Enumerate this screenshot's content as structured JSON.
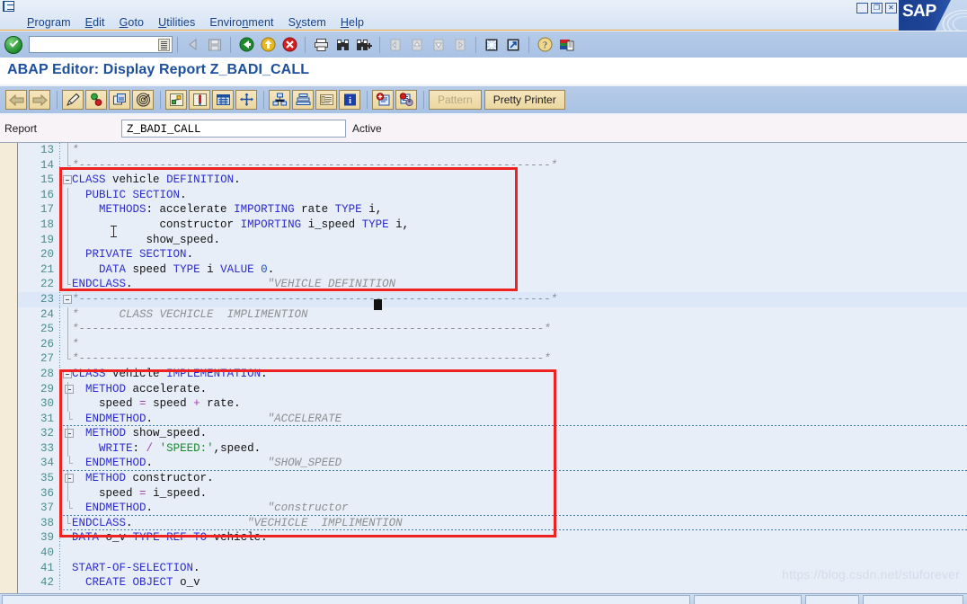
{
  "window": {
    "system_icon": "system-menu-icon",
    "controls": [
      {
        "name": "minimize-button",
        "glyph": "_"
      },
      {
        "name": "restore-button",
        "glyph": "❐"
      },
      {
        "name": "close-button",
        "glyph": "✕"
      }
    ],
    "brand": "SAP"
  },
  "menubar": {
    "items": [
      {
        "label": "Program",
        "mnemonic": "P"
      },
      {
        "label": "Edit",
        "mnemonic": "E"
      },
      {
        "label": "Goto",
        "mnemonic": "G"
      },
      {
        "label": "Utilities",
        "mnemonic": "U"
      },
      {
        "label": "Environment",
        "mnemonic": "n"
      },
      {
        "label": "System",
        "mnemonic": "y"
      },
      {
        "label": "Help",
        "mnemonic": "H"
      }
    ]
  },
  "toolbar": {
    "enter_button": "enter-ok-icon",
    "command_field": {
      "value": "",
      "placeholder": ""
    },
    "buttons": [
      {
        "name": "back-nav-icon",
        "title": "Back navigation"
      },
      {
        "name": "save-icon",
        "title": "Save"
      },
      {
        "name": "back-green-arrow-icon",
        "title": "Back"
      },
      {
        "name": "exit-yellow-arrow-icon",
        "title": "Exit"
      },
      {
        "name": "cancel-red-x-icon",
        "title": "Cancel"
      },
      {
        "name": "print-icon",
        "title": "Print"
      },
      {
        "name": "find-binoculars-icon",
        "title": "Find"
      },
      {
        "name": "find-next-icon",
        "title": "Find next"
      },
      {
        "name": "first-page-icon",
        "title": "First page"
      },
      {
        "name": "previous-page-icon",
        "title": "Previous page"
      },
      {
        "name": "next-page-icon",
        "title": "Next page"
      },
      {
        "name": "last-page-icon",
        "title": "Last page"
      },
      {
        "name": "create-session-icon",
        "title": "Create session"
      },
      {
        "name": "create-shortcut-icon",
        "title": "Create shortcut"
      },
      {
        "name": "help-question-icon",
        "title": "Help"
      },
      {
        "name": "customize-layout-icon",
        "title": "Customize local layout"
      }
    ]
  },
  "page": {
    "title": "ABAP Editor: Display Report Z_BADI_CALL"
  },
  "apptoolbar": {
    "buttons": [
      {
        "name": "back-arrow-icon",
        "title": "Back"
      },
      {
        "name": "forward-arrow-icon",
        "title": "Forward"
      },
      {
        "name": "display-change-pencil-icon",
        "title": "Display <-> Change"
      },
      {
        "name": "check-syntax-icon",
        "title": "Check"
      },
      {
        "name": "activate-icon",
        "title": "Activate"
      },
      {
        "name": "where-used-icon",
        "title": "Where-used list"
      },
      {
        "name": "navigation-stack-icon",
        "title": "Navigation"
      },
      {
        "name": "breakpoint-icon",
        "title": "Breakpoint"
      },
      {
        "name": "display-object-list-icon",
        "title": "Object list"
      },
      {
        "name": "other-object-icon",
        "title": "Other object"
      },
      {
        "name": "hierarchy-icon",
        "title": "Hierarchy"
      },
      {
        "name": "stack-layers-icon",
        "title": "Stack"
      },
      {
        "name": "list-table-icon",
        "title": "List"
      },
      {
        "name": "info-blue-icon",
        "title": "Information"
      },
      {
        "name": "insert-statement-icon",
        "title": "Insert statement"
      },
      {
        "name": "search-replace-icon",
        "title": "Search / replace"
      }
    ],
    "pattern_label": "Pattern",
    "pretty_printer_label": "Pretty Printer"
  },
  "reportrow": {
    "label": "Report",
    "value": "Z_BADI_CALL",
    "status": "Active"
  },
  "watermark": "https://blog.csdn.net/stuforever",
  "editor": {
    "lines": [
      {
        "n": "13",
        "fold": "",
        "vline": "mid",
        "text": "*"
      },
      {
        "n": "14",
        "fold": "",
        "vline": "endtick",
        "text": "*----------------------------------------------------------------------*"
      },
      {
        "n": "15",
        "fold": "minus",
        "vline": "",
        "text": "CLASS vehicle DEFINITION."
      },
      {
        "n": "16",
        "fold": "",
        "vline": "mid",
        "text": "  PUBLIC SECTION."
      },
      {
        "n": "17",
        "fold": "",
        "vline": "mid",
        "text": "    METHODS: accelerate IMPORTING rate TYPE i,"
      },
      {
        "n": "18",
        "fold": "",
        "vline": "mid",
        "text": "             constructor IMPORTING i_speed TYPE i,"
      },
      {
        "n": "19",
        "fold": "",
        "vline": "mid",
        "text": "           show_speed."
      },
      {
        "n": "20",
        "fold": "",
        "vline": "mid",
        "text": "  PRIVATE SECTION."
      },
      {
        "n": "21",
        "fold": "",
        "vline": "mid",
        "text": "    DATA speed TYPE i VALUE 0."
      },
      {
        "n": "22",
        "fold": "",
        "vline": "endtick",
        "text": "ENDCLASS.                    \"VEHICLE DEFINITION"
      },
      {
        "n": "23",
        "fold": "minus",
        "vline": "",
        "text": "*----------------------------------------------------------------------*"
      },
      {
        "n": "24",
        "fold": "",
        "vline": "mid",
        "text": "*      CLASS VECHICLE  IMPLIMENTION"
      },
      {
        "n": "25",
        "fold": "",
        "vline": "mid",
        "text": "*---------------------------------------------------------------------*"
      },
      {
        "n": "26",
        "fold": "",
        "vline": "mid",
        "text": "*"
      },
      {
        "n": "27",
        "fold": "",
        "vline": "endtick",
        "text": "*---------------------------------------------------------------------*"
      },
      {
        "n": "28",
        "fold": "minus",
        "vline": "",
        "text": "CLASS vehicle IMPLEMENTATION."
      },
      {
        "n": "29",
        "fold": "minus2",
        "vline": "mid",
        "text": "  METHOD accelerate."
      },
      {
        "n": "30",
        "fold": "",
        "vline": "mid",
        "text": "    speed = speed + rate."
      },
      {
        "n": "31",
        "fold": "",
        "vline": "endtick2",
        "text": "  ENDMETHOD.                 \"ACCELERATE"
      },
      {
        "n": "32",
        "fold": "minus2",
        "vline": "mid",
        "text": "  METHOD show_speed."
      },
      {
        "n": "33",
        "fold": "",
        "vline": "mid",
        "text": "    WRITE: / 'SPEED:',speed."
      },
      {
        "n": "34",
        "fold": "",
        "vline": "endtick2",
        "text": "  ENDMETHOD.                 \"SHOW_SPEED"
      },
      {
        "n": "35",
        "fold": "minus2",
        "vline": "mid",
        "text": "  METHOD constructor."
      },
      {
        "n": "36",
        "fold": "",
        "vline": "mid",
        "text": "    speed = i_speed."
      },
      {
        "n": "37",
        "fold": "",
        "vline": "endtick2",
        "text": "  ENDMETHOD.                 \"constructor"
      },
      {
        "n": "38",
        "fold": "",
        "vline": "endtick",
        "text": "ENDCLASS.                 \"VECHICLE  IMPLIMENTION"
      },
      {
        "n": "39",
        "fold": "",
        "vline": "",
        "text": "DATA o_v TYPE REF TO vehicle."
      },
      {
        "n": "40",
        "fold": "",
        "vline": "",
        "text": ""
      },
      {
        "n": "41",
        "fold": "",
        "vline": "",
        "text": "START-OF-SELECTION."
      },
      {
        "n": "42",
        "fold": "",
        "vline": "",
        "text": "  CREATE OBJECT o_v"
      }
    ],
    "current_line": "23",
    "separators_after": [
      "31",
      "34",
      "37",
      "38"
    ],
    "highlight_boxes": [
      {
        "name": "class-definition-highlight",
        "from_line": "15",
        "to_line": "22"
      },
      {
        "name": "class-implementation-highlight",
        "from_line": "28",
        "to_line": "38"
      }
    ]
  }
}
